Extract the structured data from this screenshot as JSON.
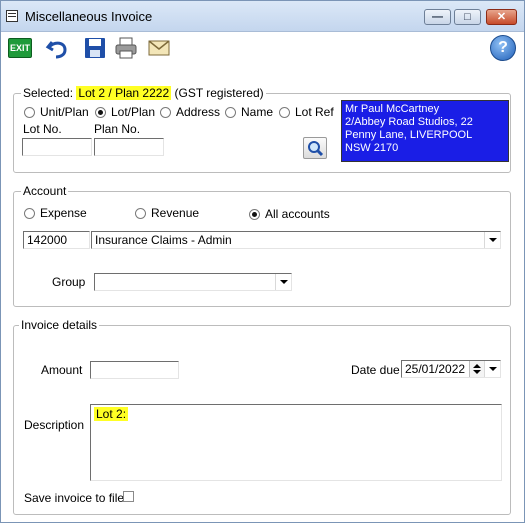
{
  "window": {
    "title": "Miscellaneous Invoice"
  },
  "toolbar": {
    "exit_label": "EXIT",
    "help_label": "?"
  },
  "selected": {
    "prefix": "Selected:",
    "value": "Lot 2 / Plan 2222",
    "suffix": "(GST registered)",
    "options": [
      "Unit/Plan",
      "Lot/Plan",
      "Address",
      "Name",
      "Lot Ref"
    ],
    "selected_option": "Lot/Plan",
    "lot_label": "Lot No.",
    "plan_label": "Plan No.",
    "lot_value": "",
    "plan_value": "",
    "address_lines": [
      "Mr Paul McCartney",
      "2/Abbey Road Studios, 22",
      "Penny Lane, LIVERPOOL",
      "NSW  2170"
    ],
    "address_bg": "#1a1ee6"
  },
  "account": {
    "legend": "Account",
    "options": [
      "Expense",
      "Revenue",
      "All accounts"
    ],
    "selected_option": "All accounts",
    "code": "142000",
    "name": "Insurance Claims - Admin",
    "group_label": "Group",
    "group_value": ""
  },
  "invoice": {
    "legend": "Invoice details",
    "amount_label": "Amount",
    "amount_value": "",
    "date_due_label": "Date due",
    "date_due_value": "25/01/2022",
    "description_label": "Description",
    "description_value": "Lot 2:",
    "save_label": "Save invoice to file",
    "save_checked": false
  },
  "colors": {
    "highlight": "#ffff24",
    "exit_green": "#1f9a3a"
  }
}
